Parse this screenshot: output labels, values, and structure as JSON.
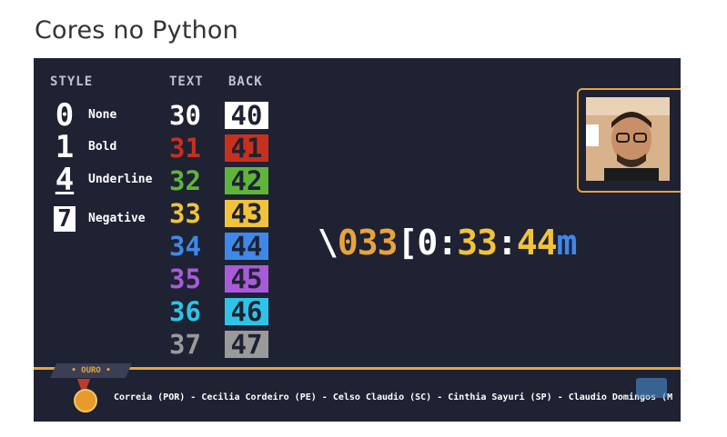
{
  "page": {
    "title": "Cores no Python"
  },
  "headers": {
    "style": "STYLE",
    "text": "TEXT",
    "back": "BACK"
  },
  "styles": [
    {
      "code": "0",
      "label": "None"
    },
    {
      "code": "1",
      "label": "Bold"
    },
    {
      "code": "4",
      "label": "Underline"
    },
    {
      "code": "7",
      "label": "Negative"
    }
  ],
  "text_codes": [
    {
      "code": "30",
      "color": "#ffffff"
    },
    {
      "code": "31",
      "color": "#c8301e"
    },
    {
      "code": "32",
      "color": "#5fb53a"
    },
    {
      "code": "33",
      "color": "#f2c33a"
    },
    {
      "code": "34",
      "color": "#3f88e8"
    },
    {
      "code": "35",
      "color": "#a85ad8"
    },
    {
      "code": "36",
      "color": "#2ec4e8"
    },
    {
      "code": "37",
      "color": "#9a9a9a"
    }
  ],
  "back_codes": [
    {
      "code": "40",
      "color": "#ffffff"
    },
    {
      "code": "41",
      "color": "#c8301e"
    },
    {
      "code": "42",
      "color": "#5fb53a"
    },
    {
      "code": "43",
      "color": "#f2c33a"
    },
    {
      "code": "44",
      "color": "#3f88e8"
    },
    {
      "code": "45",
      "color": "#a85ad8"
    },
    {
      "code": "46",
      "color": "#2ec4e8"
    },
    {
      "code": "47",
      "color": "#9a9a9a"
    }
  ],
  "escape_code": {
    "parts": [
      {
        "text": "\\",
        "color": "#ffffff"
      },
      {
        "text": "033",
        "color": "#e8a33a"
      },
      {
        "text": "[",
        "color": "#ffffff"
      },
      {
        "text": "0",
        "color": "#ffffff"
      },
      {
        "text": ":",
        "color": "#ffffff"
      },
      {
        "text": "33",
        "color": "#f2c33a"
      },
      {
        "text": ":",
        "color": "#ffffff"
      },
      {
        "text": "44",
        "color": "#f2c33a"
      },
      {
        "text": "m",
        "color": "#3f88e8"
      }
    ]
  },
  "ticker": {
    "badge": "• OURO •",
    "medal_text": "OURO",
    "text": "Correia (POR) - Cecilia Cordeiro (PE) - Celso Claudio (SC) - Cinthia Sayuri (SP) - Claudio Domingos (M"
  },
  "colors": {
    "accent": "#e8a33a",
    "background": "#1e2233"
  }
}
